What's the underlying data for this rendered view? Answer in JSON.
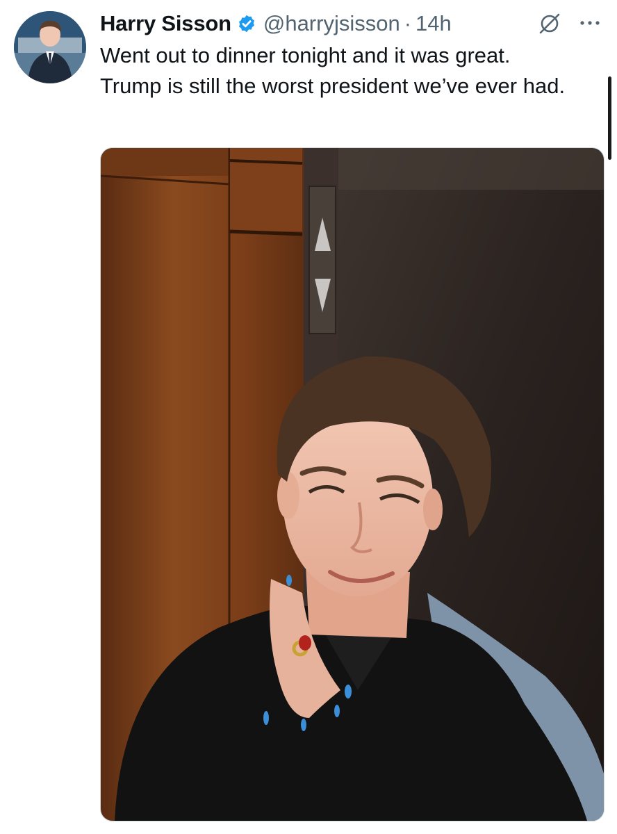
{
  "tweet": {
    "author_name": "Harry Sisson",
    "handle": "@harryjsisson",
    "separator": "·",
    "time": "14h",
    "text": "Went out to dinner tonight and it was great.\nTrump is still the worst president we’ve ever had."
  },
  "icons": {
    "avatar": "profile-photo",
    "verified": "verified-badge-icon",
    "grok": "grok-icon",
    "more": "more-options-icon"
  },
  "colors": {
    "text": "#0f1419",
    "secondary": "#536471",
    "verified": "#1d9bf0",
    "background": "#ffffff"
  }
}
